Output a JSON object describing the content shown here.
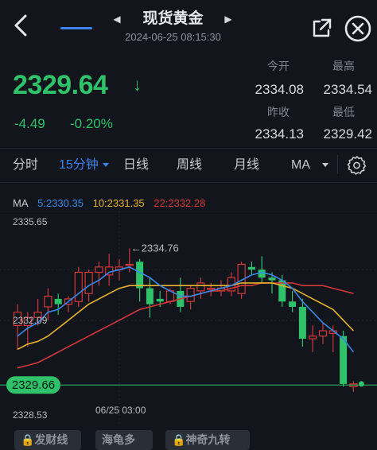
{
  "header": {
    "title": "现货黄金",
    "timestamp": "2024-06-25 08:15:30",
    "icons": [
      "back-arrow-icon",
      "chevron-left-icon",
      "chevron-right-icon",
      "share-icon",
      "close-icon"
    ]
  },
  "quote": {
    "price": "2329.64",
    "direction": "down",
    "change": "-4.49",
    "change_pct": "-0.20%",
    "stats": {
      "open_label": "今开",
      "open_value": "2334.08",
      "high_label": "最高",
      "high_value": "2334.54",
      "prev_close_label": "昨收",
      "prev_close_value": "2334.13",
      "low_label": "最低",
      "low_value": "2329.42"
    },
    "color_down": "#2fc26a"
  },
  "tabs": {
    "items": [
      "分时",
      "15分钟",
      "日线",
      "周线",
      "月线",
      "MA"
    ],
    "active": "15分钟",
    "accent": "#3d83f0"
  },
  "ma": {
    "label": "MA",
    "ma5": "5:2330.35",
    "ma10": "10:2331.35",
    "ma22": "22:2332.28",
    "colors": {
      "ma5": "#3a86e8",
      "ma10": "#e6b32e",
      "ma22": "#d0383a"
    }
  },
  "chart_data": {
    "type": "candlestick",
    "y_top_label": "2335.65",
    "y_mid_label": "2332.09",
    "y_bottom_label": "2328.53",
    "ylim": [
      2328.53,
      2335.65
    ],
    "max_marker": "2334.76",
    "x_label": "06/25 03:00",
    "current_price_label": "2329.66",
    "current_price": 2329.66,
    "colors": {
      "up": "#d0383a",
      "down": "#2fc26a"
    },
    "candles": [
      {
        "o": 2331.9,
        "h": 2332.7,
        "l": 2331.0,
        "c": 2332.4
      },
      {
        "o": 2331.9,
        "h": 2332.4,
        "l": 2331.1,
        "c": 2332.2
      },
      {
        "o": 2332.2,
        "h": 2332.9,
        "l": 2331.9,
        "c": 2332.4
      },
      {
        "o": 2332.6,
        "h": 2333.3,
        "l": 2332.1,
        "c": 2333.0
      },
      {
        "o": 2332.9,
        "h": 2333.1,
        "l": 2332.3,
        "c": 2332.7
      },
      {
        "o": 2332.7,
        "h": 2333.0,
        "l": 2332.4,
        "c": 2332.9
      },
      {
        "o": 2332.8,
        "h": 2334.1,
        "l": 2332.6,
        "c": 2333.9
      },
      {
        "o": 2333.1,
        "h": 2334.0,
        "l": 2332.8,
        "c": 2333.9
      },
      {
        "o": 2333.9,
        "h": 2334.3,
        "l": 2333.4,
        "c": 2334.1
      },
      {
        "o": 2333.8,
        "h": 2334.6,
        "l": 2333.4,
        "c": 2334.1
      },
      {
        "o": 2334.0,
        "h": 2334.4,
        "l": 2333.6,
        "c": 2334.1
      },
      {
        "o": 2334.2,
        "h": 2334.8,
        "l": 2333.9,
        "c": 2334.2
      },
      {
        "o": 2334.3,
        "h": 2334.4,
        "l": 2332.8,
        "c": 2333.3
      },
      {
        "o": 2333.3,
        "h": 2333.7,
        "l": 2332.2,
        "c": 2332.7
      },
      {
        "o": 2332.9,
        "h": 2333.2,
        "l": 2332.6,
        "c": 2332.8
      },
      {
        "o": 2332.8,
        "h": 2333.3,
        "l": 2332.7,
        "c": 2333.2
      },
      {
        "o": 2333.2,
        "h": 2333.7,
        "l": 2332.4,
        "c": 2332.6
      },
      {
        "o": 2332.8,
        "h": 2333.4,
        "l": 2332.5,
        "c": 2333.3
      },
      {
        "o": 2333.2,
        "h": 2333.7,
        "l": 2332.9,
        "c": 2333.5
      },
      {
        "o": 2333.3,
        "h": 2333.5,
        "l": 2333.0,
        "c": 2333.3
      },
      {
        "o": 2333.2,
        "h": 2333.6,
        "l": 2333.0,
        "c": 2333.3
      },
      {
        "o": 2333.2,
        "h": 2333.9,
        "l": 2333.0,
        "c": 2333.7
      },
      {
        "o": 2333.1,
        "h": 2334.3,
        "l": 2332.9,
        "c": 2334.2
      },
      {
        "o": 2334.1,
        "h": 2334.3,
        "l": 2333.8,
        "c": 2334.0
      },
      {
        "o": 2334.0,
        "h": 2334.5,
        "l": 2333.5,
        "c": 2333.7
      },
      {
        "o": 2333.7,
        "h": 2333.9,
        "l": 2333.1,
        "c": 2333.6
      },
      {
        "o": 2333.6,
        "h": 2333.8,
        "l": 2332.6,
        "c": 2332.8
      },
      {
        "o": 2332.8,
        "h": 2333.2,
        "l": 2332.4,
        "c": 2332.6
      },
      {
        "o": 2332.6,
        "h": 2332.9,
        "l": 2331.1,
        "c": 2331.4
      },
      {
        "o": 2331.4,
        "h": 2331.9,
        "l": 2330.9,
        "c": 2331.5
      },
      {
        "o": 2331.5,
        "h": 2332.0,
        "l": 2331.2,
        "c": 2331.7
      },
      {
        "o": 2331.6,
        "h": 2331.9,
        "l": 2330.9,
        "c": 2331.7
      },
      {
        "o": 2331.5,
        "h": 2331.7,
        "l": 2329.6,
        "c": 2329.7
      },
      {
        "o": 2329.6,
        "h": 2329.8,
        "l": 2329.4,
        "c": 2329.7
      }
    ],
    "ma5": [
      2331.5,
      2331.8,
      2332.0,
      2332.4,
      2332.5,
      2332.8,
      2333.1,
      2333.4,
      2333.6,
      2333.9,
      2334.0,
      2334.1,
      2333.9,
      2333.7,
      2333.4,
      2333.2,
      2333.0,
      2333.0,
      2333.1,
      2333.2,
      2333.3,
      2333.4,
      2333.6,
      2333.8,
      2333.9,
      2333.8,
      2333.6,
      2333.3,
      2332.8,
      2332.4,
      2332.0,
      2331.7,
      2331.4,
      2330.9
    ],
    "ma10": [
      2331.0,
      2331.2,
      2331.3,
      2331.5,
      2331.8,
      2332.1,
      2332.4,
      2332.7,
      2332.9,
      2333.1,
      2333.3,
      2333.4,
      2333.4,
      2333.4,
      2333.4,
      2333.4,
      2333.4,
      2333.4,
      2333.4,
      2333.4,
      2333.4,
      2333.4,
      2333.5,
      2333.5,
      2333.5,
      2333.5,
      2333.4,
      2333.3,
      2333.1,
      2332.9,
      2332.7,
      2332.5,
      2332.1,
      2331.7
    ],
    "ma22": [
      2330.3,
      2330.4,
      2330.5,
      2330.7,
      2330.9,
      2331.1,
      2331.3,
      2331.5,
      2331.7,
      2331.9,
      2332.1,
      2332.3,
      2332.5,
      2332.6,
      2332.7,
      2332.8,
      2332.9,
      2333.0,
      2333.1,
      2333.2,
      2333.2,
      2333.3,
      2333.4,
      2333.4,
      2333.5,
      2333.5,
      2333.5,
      2333.5,
      2333.4,
      2333.4,
      2333.4,
      2333.3,
      2333.2,
      2333.1
    ]
  },
  "bottom_actions": [
    "发财线",
    "海龟多",
    "神奇九转"
  ]
}
